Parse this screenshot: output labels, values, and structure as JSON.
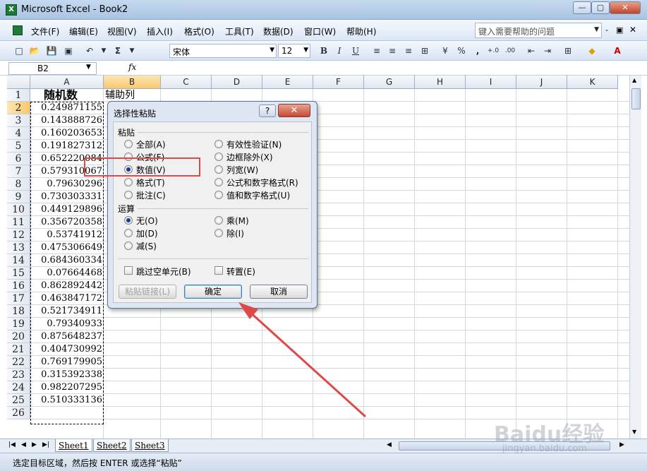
{
  "window": {
    "title": "Microsoft Excel - Book2",
    "app_icon": "excel-icon"
  },
  "menu": {
    "items": [
      "文件(F)",
      "编辑(E)",
      "视图(V)",
      "插入(I)",
      "格式(O)",
      "工具(T)",
      "数据(D)",
      "窗口(W)",
      "帮助(H)"
    ],
    "help_placeholder": "键入需要帮助的问题"
  },
  "toolbar": {
    "font_name": "宋体",
    "font_size": "12",
    "bold": "B",
    "italic": "I",
    "underline": "U",
    "sigma": "Σ",
    "percent": "%",
    "comma": ","
  },
  "formula_bar": {
    "name_box": "B2",
    "fx": "fx",
    "value": ""
  },
  "grid": {
    "columns": [
      "A",
      "B",
      "C",
      "D",
      "E",
      "F",
      "G",
      "H",
      "I",
      "J",
      "K"
    ],
    "rows": [
      "1",
      "2",
      "3",
      "4",
      "5",
      "6",
      "7",
      "8",
      "9",
      "10",
      "11",
      "12",
      "13",
      "14",
      "15",
      "16",
      "17",
      "18",
      "19",
      "20",
      "21",
      "22",
      "23",
      "24",
      "25",
      "26"
    ],
    "A1": "随机数",
    "B1": "辅助列",
    "A_values": [
      "0.249871155",
      "0.143888726",
      "0.160203653",
      "0.191827312",
      "0.652220084",
      "0.579310067",
      "0.79630296",
      "0.730303331",
      "0.449129896",
      "0.356720358",
      "0.53741912",
      "0.475306649",
      "0.684360334",
      "0.07664468",
      "0.862892442",
      "0.463847172",
      "0.521734911",
      "0.79340933",
      "0.875648237",
      "0.404730992",
      "0.769179905",
      "0.315392338",
      "0.982207295",
      "0.510333136"
    ]
  },
  "sheets": [
    "Sheet1",
    "Sheet2",
    "Sheet3"
  ],
  "status": "选定目标区域，然后按 ENTER 或选择“粘贴”",
  "dialog": {
    "title": "选择性粘贴",
    "help": "?",
    "close": "✕",
    "paste_label": "粘贴",
    "paste_options_left": [
      "全部(A)",
      "公式(F)",
      "数值(V)",
      "格式(T)",
      "批注(C)"
    ],
    "paste_options_right": [
      "有效性验证(N)",
      "边框除外(X)",
      "列宽(W)",
      "公式和数字格式(R)",
      "值和数字格式(U)"
    ],
    "operation_label": "运算",
    "operation_left": [
      "无(O)",
      "加(D)",
      "减(S)"
    ],
    "operation_right": [
      "乘(M)",
      "除(I)"
    ],
    "skip_blanks": "跳过空单元(B)",
    "transpose": "转置(E)",
    "paste_link": "粘贴链接(L)",
    "ok": "确定",
    "cancel": "取消"
  },
  "watermark": {
    "text": "Baidu经验",
    "url": "jingyan.baidu.com"
  }
}
